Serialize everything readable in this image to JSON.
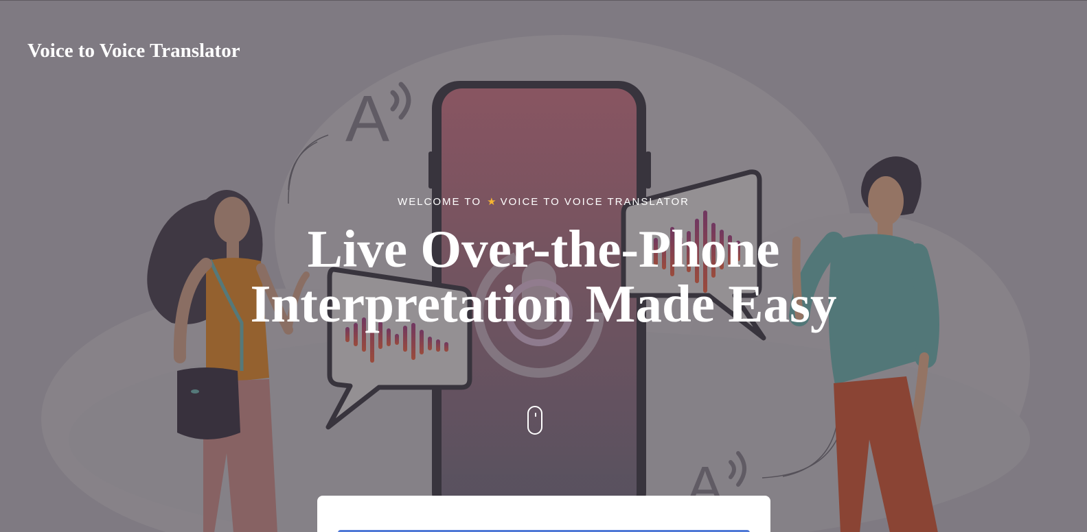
{
  "header": {
    "brand": "Voice to Voice Translator"
  },
  "hero": {
    "welcome_prefix": "WELCOME TO",
    "welcome_icon": "star-icon",
    "welcome_brand": "VOICE TO VOICE TRANSLATOR",
    "headline_line1": "Live Over-the-Phone",
    "headline_line2": "Interpretation Made Easy",
    "illustration_glyph_top": "A",
    "illustration_glyph_bottom": "A",
    "scroll_icon": "mouse-scroll-icon"
  },
  "colors": {
    "overlay_bg": "#817c84",
    "headline_text": "#ffffff",
    "star_accent": "#f6b531",
    "phone_gradient_top": "#8c4f5c",
    "phone_gradient_bottom": "#4f4a5a",
    "cta_accent": "#4f78d6",
    "shirt_teal": "#4a7878",
    "pants_red": "#8e3a25",
    "top_orange": "#9a5d1f"
  }
}
